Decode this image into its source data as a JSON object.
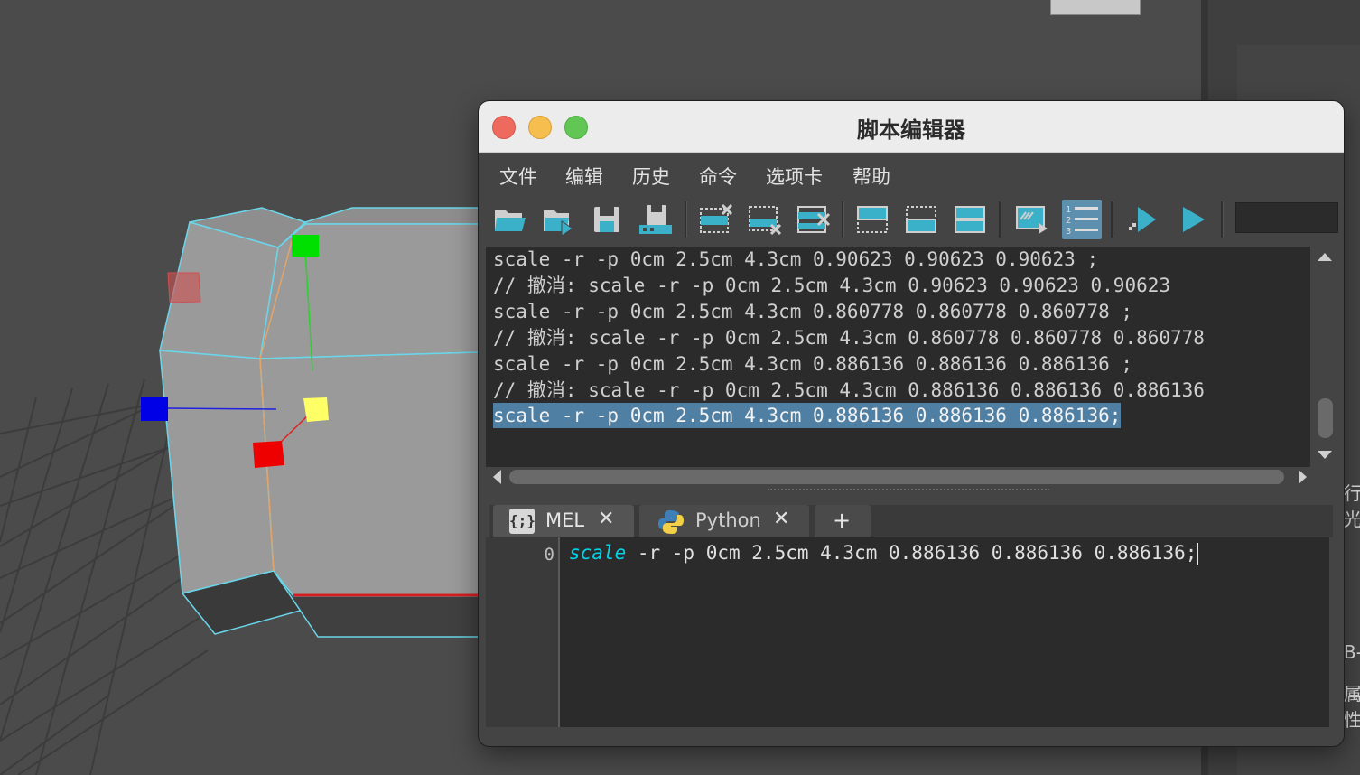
{
  "window": {
    "title": "脚本编辑器",
    "menu": [
      "文件",
      "编辑",
      "历史",
      "命令",
      "选项卡",
      "帮助"
    ]
  },
  "toolbar": {
    "icons": [
      "open-script-icon",
      "source-script-icon",
      "save-script-icon",
      "save-to-shelf-icon",
      "clear-history-icon",
      "clear-input-icon",
      "clear-all-icon",
      "show-history-icon",
      "show-input-icon",
      "show-both-icon",
      "echo-all-commands-icon",
      "show-line-numbers-icon",
      "execute-selected-icon",
      "execute-all-icon"
    ]
  },
  "history": {
    "lines": [
      "scale -r -p 0cm 2.5cm 4.3cm 0.90623 0.90623 0.90623 ;",
      "// 撤消: scale -r -p 0cm 2.5cm 4.3cm 0.90623 0.90623 0.90623",
      "scale -r -p 0cm 2.5cm 4.3cm 0.860778 0.860778 0.860778 ;",
      "// 撤消: scale -r -p 0cm 2.5cm 4.3cm 0.860778 0.860778 0.860778",
      "scale -r -p 0cm 2.5cm 4.3cm 0.886136 0.886136 0.886136 ;",
      "// 撤消: scale -r -p 0cm 2.5cm 4.3cm 0.886136 0.886136 0.886136",
      "scale -r -p 0cm 2.5cm 4.3cm 0.886136 0.886136 0.886136;"
    ],
    "selected_index": 6
  },
  "tabs": [
    {
      "label": "MEL",
      "icon": "mel-braces-icon",
      "close": "✕"
    },
    {
      "label": "Python",
      "icon": "python-logo-icon",
      "close": "✕"
    },
    {
      "label": "+"
    }
  ],
  "editor": {
    "line_number": "0",
    "keyword": "scale",
    "rest": " -r -p 0cm 2.5cm 4.3cm 0.886136 0.886136 0.886136;"
  },
  "right_panel": {
    "fragments": [
      "行光",
      "B-",
      "属性"
    ]
  },
  "colors": {
    "selection": "#4f7fa3",
    "keyword": "#00d4e8",
    "toolbar_accent": "#3bb0c9"
  }
}
